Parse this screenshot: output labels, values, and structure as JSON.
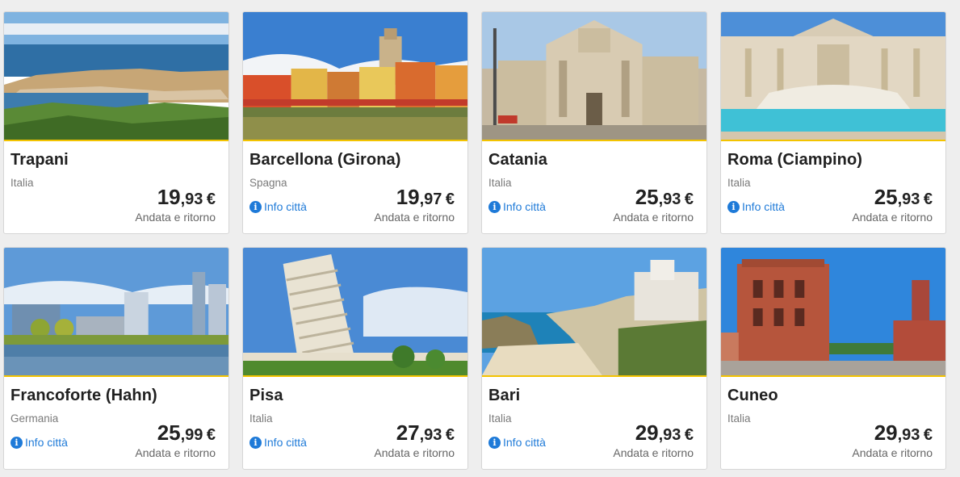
{
  "cards": [
    {
      "city": "Trapani",
      "country": "Italia",
      "price_int": "19",
      "price_dec": ",93",
      "currency": "€",
      "trip": "Andata e ritorno",
      "photo": "coastal-town-harbor-photo"
    },
    {
      "city": "Barcellona (Girona)",
      "country": "Spagna",
      "info": "Info città",
      "price_int": "19",
      "price_dec": ",97",
      "currency": "€",
      "trip": "Andata e ritorno",
      "photo": "colorful-river-houses-photo"
    },
    {
      "city": "Catania",
      "country": "Italia",
      "info": "Info città",
      "price_int": "25",
      "price_dec": ",93",
      "currency": "€",
      "trip": "Andata e ritorno",
      "photo": "cathedral-square-photo"
    },
    {
      "city": "Roma (Ciampino)",
      "country": "Italia",
      "info": "Info città",
      "price_int": "25",
      "price_dec": ",93",
      "currency": "€",
      "trip": "Andata e ritorno",
      "photo": "trevi-fountain-photo"
    },
    {
      "city": "Francoforte (Hahn)",
      "country": "Germania",
      "info": "Info città",
      "price_int": "25",
      "price_dec": ",99",
      "currency": "€",
      "trip": "Andata e ritorno",
      "photo": "city-skyline-river-photo"
    },
    {
      "city": "Pisa",
      "country": "Italia",
      "info": "Info città",
      "price_int": "27",
      "price_dec": ",93",
      "currency": "€",
      "trip": "Andata e ritorno",
      "photo": "leaning-tower-photo"
    },
    {
      "city": "Bari",
      "country": "Italia",
      "info": "Info città",
      "price_int": "29",
      "price_dec": ",93",
      "currency": "€",
      "trip": "Andata e ritorno",
      "photo": "cliff-beach-town-photo"
    },
    {
      "city": "Cuneo",
      "country": "Italia",
      "price_int": "29",
      "price_dec": ",93",
      "currency": "€",
      "trip": "Andata e ritorno",
      "photo": "brick-tower-building-photo"
    }
  ],
  "colors": {
    "accent": "#f3c300",
    "link": "#1e7ad8",
    "text": "#202020",
    "muted": "#7a7a7a"
  },
  "icons": {
    "info": "info-circle-icon"
  }
}
